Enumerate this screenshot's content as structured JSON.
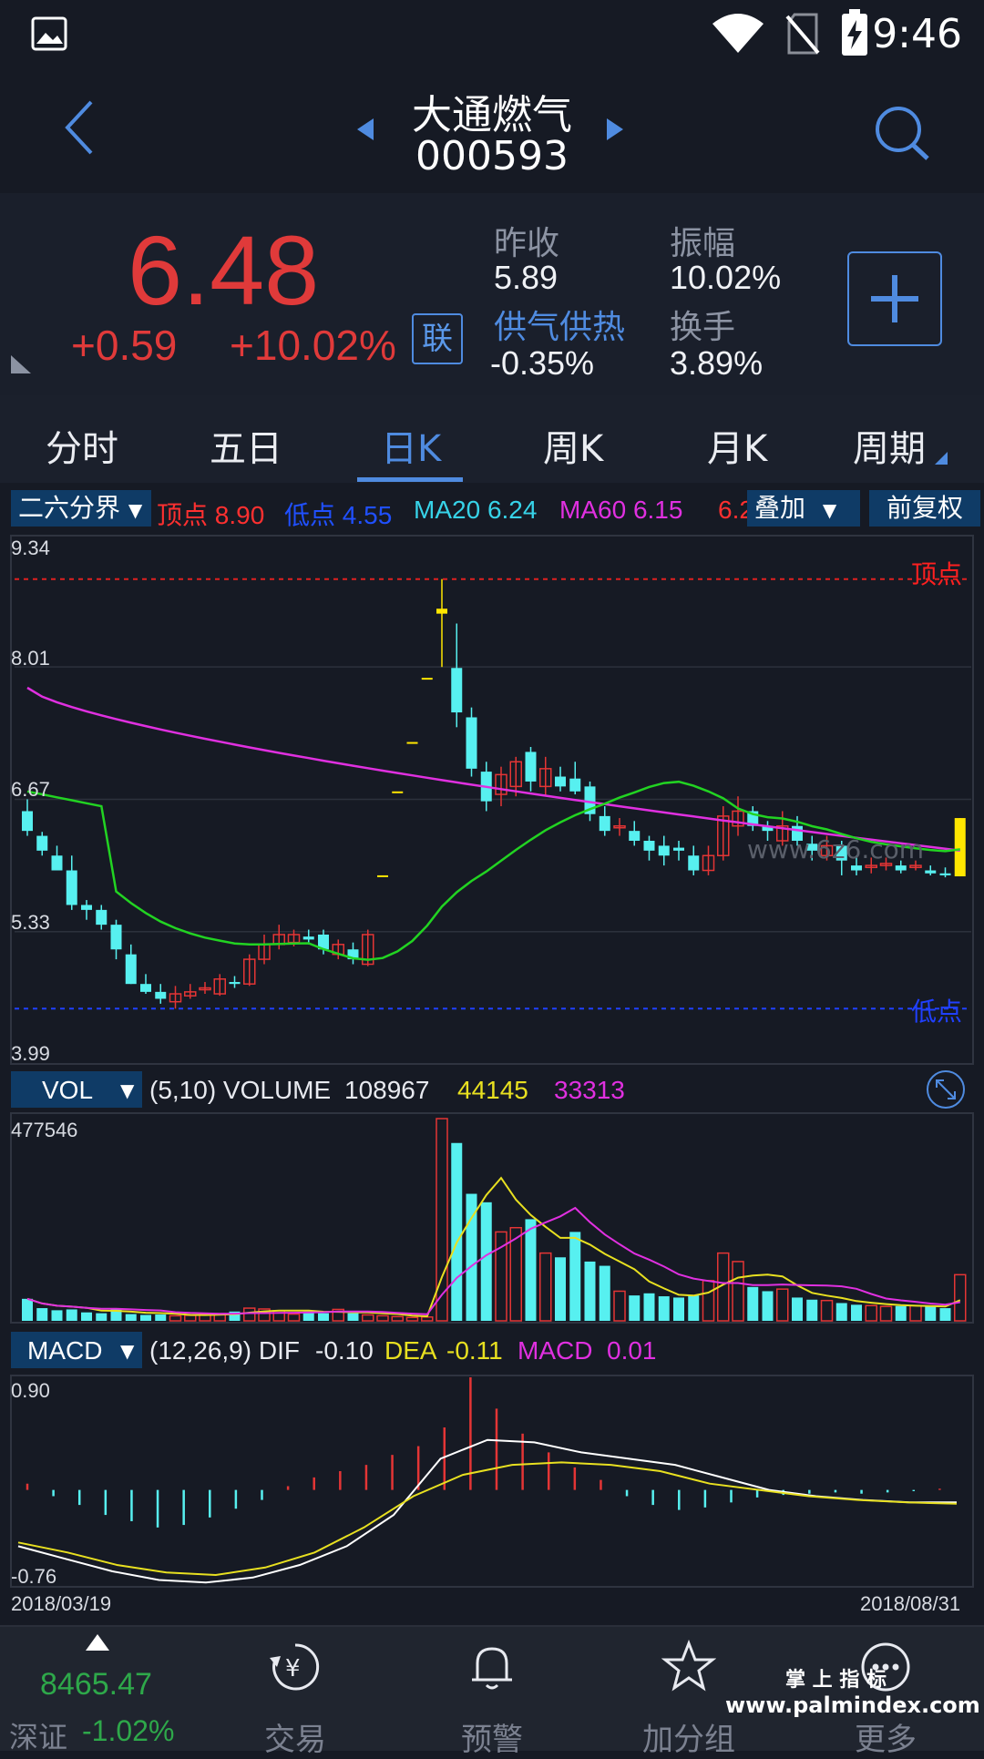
{
  "status": {
    "time": "9:46"
  },
  "header": {
    "name": "大通燃气",
    "code": "000593"
  },
  "quote": {
    "price": "6.48",
    "change": "+0.59",
    "change_pct": "+10.02%",
    "badge": "联",
    "fields": [
      {
        "label": "昨收",
        "value": "5.89"
      },
      {
        "label": "振幅",
        "value": "10.02%"
      },
      {
        "label": "供气供热",
        "value": "-0.35%"
      },
      {
        "label": "换手",
        "value": "3.89%"
      }
    ]
  },
  "tabs": [
    "分时",
    "五日",
    "日K",
    "周K",
    "月K",
    "周期"
  ],
  "active_tab": "日K",
  "main_indicator": {
    "selector": "二六分界",
    "items": [
      {
        "label": "顶点",
        "value": "8.90",
        "color": "#ff3030"
      },
      {
        "label": "低点",
        "value": "4.55",
        "color": "#2040ff"
      },
      {
        "label": "MA20",
        "value": "6.24",
        "color": "#37d3e8"
      },
      {
        "label": "MA60",
        "value": "6.15",
        "color": "#e030e0"
      },
      {
        "label": "",
        "value": "6.2",
        "color": "#ff3030"
      }
    ],
    "overlay_label": "叠加",
    "adjust_label": "前复权",
    "top_label": "顶点",
    "low_label": "低点"
  },
  "price_axis": {
    "max": "9.34",
    "l2": "8.01",
    "l3": "6.67",
    "l4": "5.33",
    "min": "3.99"
  },
  "vol_indicator": {
    "selector": "VOL",
    "params": "(5,10) VOLUME",
    "volume": "108967",
    "ma5": "44145",
    "ma10": "33313",
    "max": "477546"
  },
  "macd_indicator": {
    "selector": "MACD",
    "params": "(12,26,9) DIF",
    "dif": "-0.10",
    "dea_label": "DEA",
    "dea": "-0.11",
    "macd_label": "MACD",
    "macd": "0.01",
    "max": "0.90",
    "min": "-0.76"
  },
  "dates": {
    "start": "2018/03/19",
    "end": "2018/08/31"
  },
  "watermark": "www.6z6.com",
  "chart_data": {
    "type": "candlestick",
    "price_range": [
      3.99,
      9.34
    ],
    "candles_ohlc": [
      [
        6.55,
        6.35,
        6.67,
        6.3
      ],
      [
        6.3,
        6.15,
        6.34,
        6.1
      ],
      [
        6.1,
        5.95,
        6.2,
        5.95
      ],
      [
        5.95,
        5.6,
        6.1,
        5.55
      ],
      [
        5.6,
        5.55,
        5.65,
        5.45
      ],
      [
        5.55,
        5.4,
        5.6,
        5.35
      ],
      [
        5.4,
        5.15,
        5.45,
        5.05
      ],
      [
        5.1,
        4.8,
        5.2,
        4.8
      ],
      [
        4.8,
        4.72,
        4.9,
        4.7
      ],
      [
        4.72,
        4.65,
        4.8,
        4.6
      ],
      [
        4.62,
        4.7,
        4.78,
        4.55
      ],
      [
        4.68,
        4.72,
        4.8,
        4.65
      ],
      [
        4.76,
        4.76,
        4.82,
        4.7
      ],
      [
        4.7,
        4.85,
        4.9,
        4.68
      ],
      [
        4.82,
        4.8,
        4.88,
        4.76
      ],
      [
        4.8,
        5.05,
        5.1,
        4.78
      ],
      [
        5.05,
        5.2,
        5.3,
        5.0
      ],
      [
        5.2,
        5.3,
        5.4,
        5.15
      ],
      [
        5.22,
        5.3,
        5.35,
        5.18
      ],
      [
        5.28,
        5.25,
        5.35,
        5.2
      ],
      [
        5.3,
        5.15,
        5.35,
        5.1
      ],
      [
        5.1,
        5.2,
        5.25,
        5.05
      ],
      [
        5.15,
        5.05,
        5.22,
        5.0
      ],
      [
        5.0,
        5.3,
        5.35,
        4.98
      ],
      [
        5.9,
        5.9,
        5.9,
        5.9
      ],
      [
        6.75,
        6.75,
        6.75,
        6.75
      ],
      [
        7.25,
        7.25,
        7.25,
        7.25
      ],
      [
        7.9,
        7.9,
        7.9,
        7.9
      ],
      [
        8.55,
        8.6,
        8.9,
        8.01
      ],
      [
        8.0,
        7.55,
        8.45,
        7.4
      ],
      [
        7.5,
        6.98,
        7.6,
        6.9
      ],
      [
        6.95,
        6.65,
        7.05,
        6.55
      ],
      [
        6.72,
        6.92,
        7.0,
        6.6
      ],
      [
        6.8,
        7.05,
        7.1,
        6.7
      ],
      [
        7.15,
        6.85,
        7.2,
        6.75
      ],
      [
        6.8,
        6.98,
        7.1,
        6.7
      ],
      [
        6.9,
        6.8,
        7.0,
        6.75
      ],
      [
        6.88,
        6.75,
        7.05,
        6.72
      ],
      [
        6.8,
        6.52,
        6.85,
        6.45
      ],
      [
        6.5,
        6.35,
        6.6,
        6.3
      ],
      [
        6.4,
        6.4,
        6.48,
        6.3
      ],
      [
        6.35,
        6.25,
        6.45,
        6.2
      ],
      [
        6.25,
        6.15,
        6.3,
        6.05
      ],
      [
        6.2,
        6.1,
        6.3,
        6.0
      ],
      [
        6.18,
        6.15,
        6.25,
        6.05
      ],
      [
        6.1,
        5.95,
        6.2,
        5.9
      ],
      [
        5.95,
        6.1,
        6.2,
        5.9
      ],
      [
        6.1,
        6.5,
        6.6,
        6.05
      ],
      [
        6.4,
        6.55,
        6.7,
        6.3
      ],
      [
        6.55,
        6.4,
        6.6,
        6.35
      ],
      [
        6.4,
        6.35,
        6.45,
        6.25
      ],
      [
        6.25,
        6.4,
        6.55,
        6.2
      ],
      [
        6.4,
        6.25,
        6.5,
        6.2
      ],
      [
        6.22,
        6.15,
        6.3,
        6.05
      ],
      [
        6.1,
        6.2,
        6.3,
        6.05
      ],
      [
        6.2,
        6.05,
        6.25,
        5.9
      ],
      [
        6.0,
        5.95,
        6.1,
        5.9
      ],
      [
        5.98,
        6.0,
        6.08,
        5.92
      ],
      [
        6.0,
        6.02,
        6.08,
        5.95
      ],
      [
        6.0,
        5.95,
        6.05,
        5.92
      ],
      [
        5.98,
        6.0,
        6.05,
        5.95
      ],
      [
        5.95,
        5.92,
        6.0,
        5.9
      ],
      [
        5.92,
        5.9,
        5.98,
        5.88
      ],
      [
        5.89,
        6.48,
        6.48,
        5.89
      ]
    ],
    "volume_range": [
      0,
      477546
    ],
    "volume": [
      52000,
      30000,
      25000,
      27000,
      20000,
      18000,
      28000,
      16000,
      14000,
      15000,
      12000,
      13000,
      15000,
      17000,
      22000,
      30000,
      28000,
      24000,
      16000,
      22000,
      18000,
      27000,
      18000,
      14000,
      12000,
      10000,
      8000,
      9000,
      477546,
      420000,
      300000,
      280000,
      210000,
      220000,
      240000,
      160000,
      150000,
      210000,
      140000,
      130000,
      70000,
      60000,
      65000,
      58000,
      55000,
      60000,
      95000,
      160000,
      140000,
      80000,
      70000,
      75000,
      55000,
      50000,
      48000,
      42000,
      38000,
      36000,
      34000,
      35000,
      36000,
      34000,
      30000,
      108967
    ],
    "macd_range": [
      -0.76,
      0.9
    ],
    "macd_hist_sample": [
      0.05,
      -0.05,
      -0.12,
      -0.2,
      -0.25,
      -0.3,
      -0.28,
      -0.22,
      -0.15,
      -0.08,
      0.03,
      0.1,
      0.15,
      0.2,
      0.28,
      0.35,
      0.5,
      0.9,
      0.65,
      0.45,
      0.3,
      0.18,
      0.08,
      -0.05,
      -0.12,
      -0.16,
      -0.14,
      -0.1,
      -0.06,
      -0.04,
      -0.03,
      -0.02,
      -0.03,
      -0.02,
      -0.01,
      0.01
    ],
    "dif_sample": [
      -0.45,
      -0.55,
      -0.65,
      -0.72,
      -0.74,
      -0.7,
      -0.6,
      -0.45,
      -0.2,
      0.25,
      0.4,
      0.38,
      0.3,
      0.25,
      0.2,
      0.1,
      0.0,
      -0.05,
      -0.08,
      -0.1,
      -0.1
    ],
    "dea_sample": [
      -0.42,
      -0.5,
      -0.6,
      -0.66,
      -0.68,
      -0.62,
      -0.5,
      -0.3,
      -0.05,
      0.12,
      0.2,
      0.22,
      0.2,
      0.15,
      0.05,
      0.0,
      -0.05,
      -0.08,
      -0.1,
      -0.11
    ]
  },
  "bottom_nav": {
    "index_value": "8465.47",
    "index_name": "深证",
    "index_change": "-1.02%",
    "items": [
      "交易",
      "预警",
      "加分组",
      "更多"
    ]
  },
  "corner_watermark": {
    "line1": "掌 上 指 标",
    "line2": "www.palmindex.com"
  }
}
